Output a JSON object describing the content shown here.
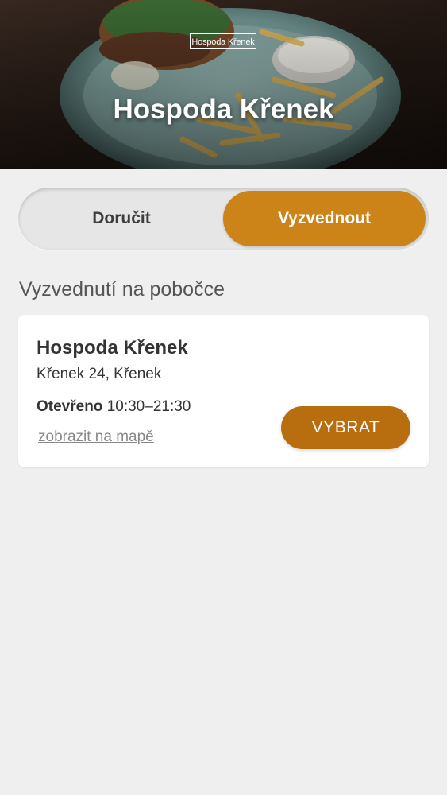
{
  "hero": {
    "logo_text": "Hospoda Křenek",
    "title": "Hospoda Křenek"
  },
  "mode_toggle": {
    "options": [
      {
        "label": "Doručit",
        "selected": false
      },
      {
        "label": "Vyzvednout",
        "selected": true
      }
    ]
  },
  "section": {
    "title": "Vyzvednutí na pobočce"
  },
  "branch": {
    "name": "Hospoda Křenek",
    "address": "Křenek 24, Křenek",
    "hours_label": "Otevřeno",
    "hours_value": "10:30–21:30",
    "map_link": "zobrazit na mapě",
    "select_label": "VYBRAT"
  },
  "colors": {
    "accent": "#cc8419",
    "button": "#b86e0e",
    "background": "#efefef"
  }
}
